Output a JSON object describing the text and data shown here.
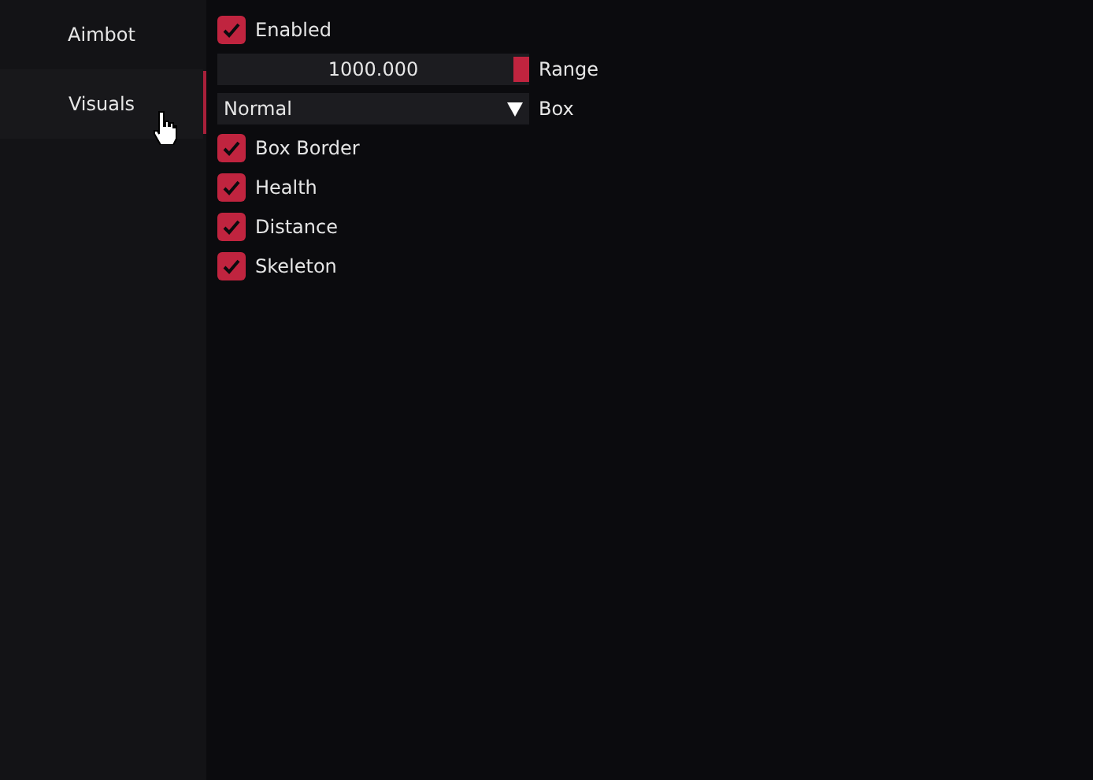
{
  "sidebar": {
    "tabs": [
      {
        "label": "Aimbot",
        "selected": false
      },
      {
        "label": "Visuals",
        "selected": true
      }
    ]
  },
  "settings": [
    {
      "kind": "checkbox",
      "label": "Enabled",
      "checked": true
    },
    {
      "kind": "slider",
      "label": "Range",
      "reading": "1000.000",
      "level": 1
    },
    {
      "kind": "combo",
      "label": "Box",
      "option": "Normal"
    },
    {
      "kind": "checkbox",
      "label": "Box Border",
      "checked": true
    },
    {
      "kind": "checkbox",
      "label": "Health",
      "checked": true
    },
    {
      "kind": "checkbox",
      "label": "Distance",
      "checked": true
    },
    {
      "kind": "checkbox",
      "label": "Skeleton",
      "checked": true
    }
  ]
}
